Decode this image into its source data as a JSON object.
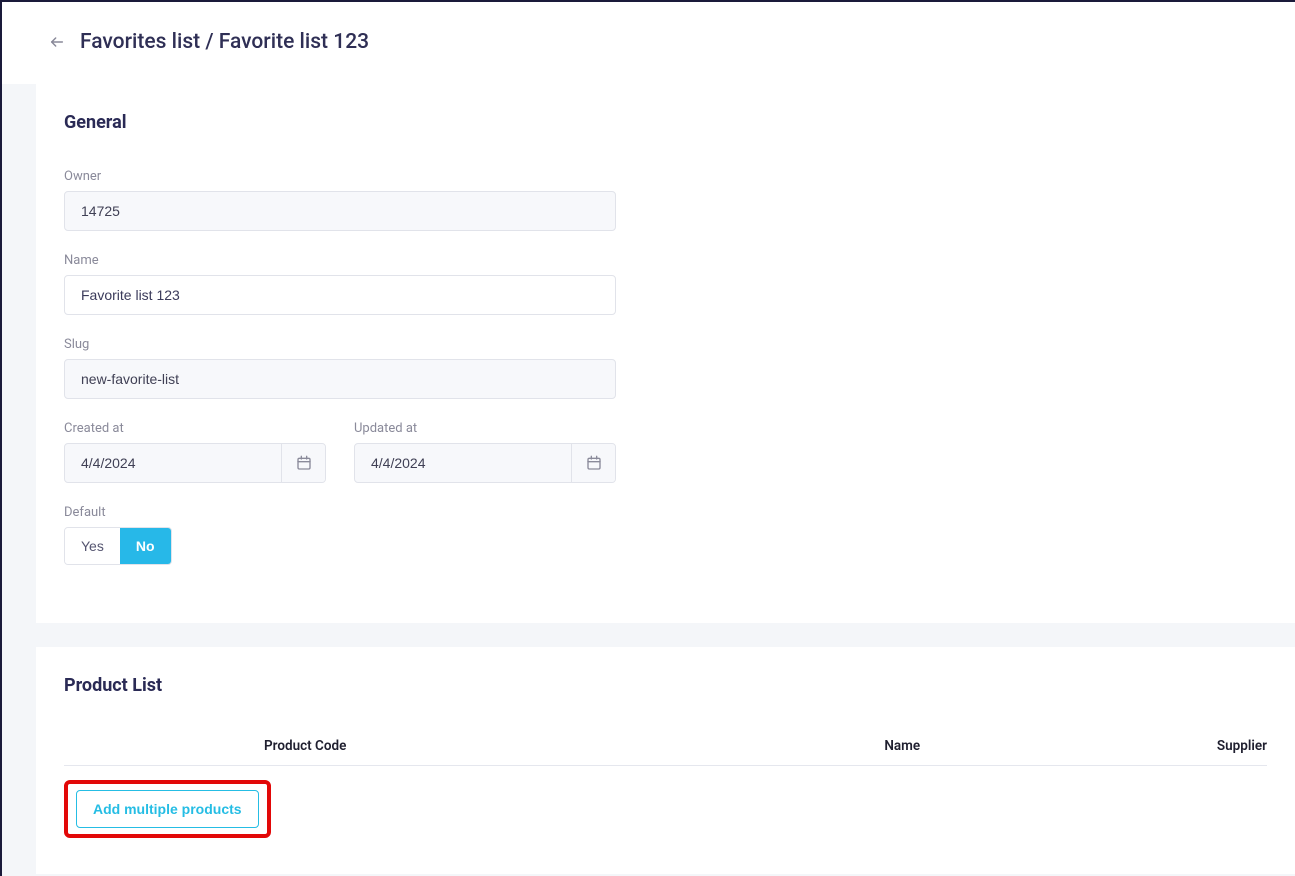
{
  "header": {
    "breadcrumb": "Favorites list / Favorite list 123"
  },
  "general": {
    "title": "General",
    "owner_label": "Owner",
    "owner_value": "14725",
    "name_label": "Name",
    "name_value": "Favorite list 123",
    "slug_label": "Slug",
    "slug_value": "new-favorite-list",
    "created_label": "Created at",
    "created_value": "4/4/2024",
    "updated_label": "Updated at",
    "updated_value": "4/4/2024",
    "default_label": "Default",
    "default_yes": "Yes",
    "default_no": "No"
  },
  "product_list": {
    "title": "Product List",
    "columns": {
      "code": "Product Code",
      "name": "Name",
      "supplier": "Supplier"
    },
    "add_button": "Add multiple products"
  }
}
